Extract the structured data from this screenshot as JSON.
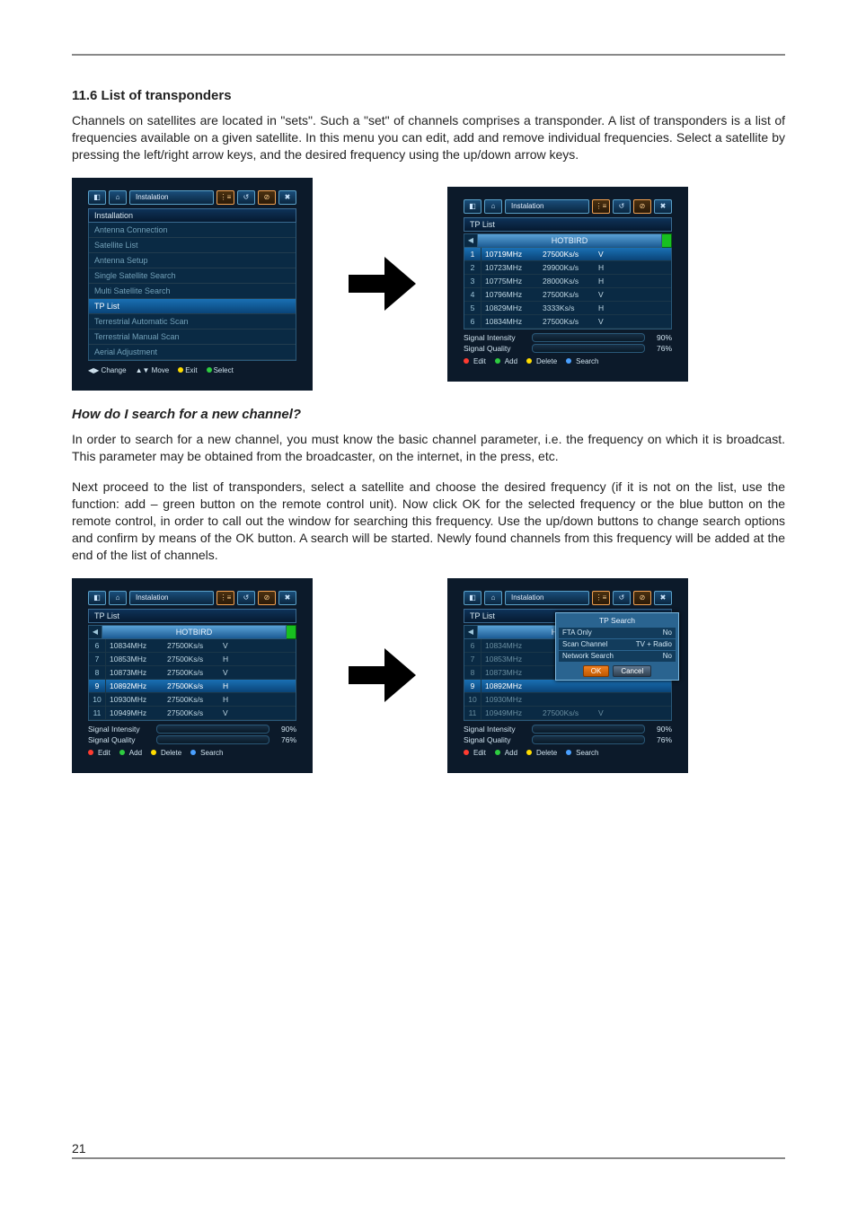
{
  "page_number": "21",
  "section_heading": "11.6 List of transponders",
  "para1": "Channels on satellites are located in \"sets\". Such a \"set\" of channels comprises a transponder. A list of transponders is a list of frequencies available on a given satellite. In this menu you can edit, add and remove individual frequencies. Select a satellite by pressing the left/right arrow keys, and the desired frequency using the up/down arrow keys.",
  "subquestion": "How do I search for a new channel?",
  "para2": "In order to search for a new channel, you must know the basic channel parameter, i.e. the frequency on which it is broadcast. This parameter may be obtained from the broadcaster, on the internet, in the press, etc.",
  "para3": "Next proceed to the list of transponders, select a satellite and choose the desired frequency (if it is not on the list, use the function: add – green button on the remote control unit). Now click OK for the selected frequency or the blue button on the remote control, in order to call out the window for searching this frequency. Use the up/down buttons to change search options and confirm by means of the OK button. A search will be started. Newly found channels from this frequency will be added at the end of the list of channels.",
  "tv_header_title": "Instalation",
  "hicons": [
    "◧",
    "⌂",
    "⋮≡",
    "↺",
    "⊘",
    "✖"
  ],
  "install_menu": {
    "title": "Installation",
    "items": [
      "Antenna Connection",
      "Satellite List",
      "Antenna Setup",
      "Single Satellite Search",
      "Multi Satellite Search",
      "TP List",
      "Terrestrial Automatic Scan",
      "Terrestrial Manual Scan",
      "Aerial Adjustment"
    ],
    "selected": 5,
    "hints": {
      "change": "Change",
      "move": "Move",
      "exit": "Exit",
      "select": "Select",
      "chlabel": "◀▶",
      "mvlabel": "▲▼"
    }
  },
  "tplist": {
    "title": "TP List",
    "corner_glyph": "◀",
    "satellite": "HOTBIRD",
    "rows1": [
      {
        "num": "1",
        "freq": "10719MHz",
        "sr": "27500Ks/s",
        "pol": "V",
        "sel": true
      },
      {
        "num": "2",
        "freq": "10723MHz",
        "sr": "29900Ks/s",
        "pol": "H"
      },
      {
        "num": "3",
        "freq": "10775MHz",
        "sr": "28000Ks/s",
        "pol": "H"
      },
      {
        "num": "4",
        "freq": "10796MHz",
        "sr": "27500Ks/s",
        "pol": "V"
      },
      {
        "num": "5",
        "freq": "10829MHz",
        "sr": "3333Ks/s",
        "pol": "H"
      },
      {
        "num": "6",
        "freq": "10834MHz",
        "sr": "27500Ks/s",
        "pol": "V"
      }
    ],
    "rows2": [
      {
        "num": "6",
        "freq": "10834MHz",
        "sr": "27500Ks/s",
        "pol": "V"
      },
      {
        "num": "7",
        "freq": "10853MHz",
        "sr": "27500Ks/s",
        "pol": "H"
      },
      {
        "num": "8",
        "freq": "10873MHz",
        "sr": "27500Ks/s",
        "pol": "V"
      },
      {
        "num": "9",
        "freq": "10892MHz",
        "sr": "27500Ks/s",
        "pol": "H",
        "sel": true
      },
      {
        "num": "10",
        "freq": "10930MHz",
        "sr": "27500Ks/s",
        "pol": "H"
      },
      {
        "num": "11",
        "freq": "10949MHz",
        "sr": "27500Ks/s",
        "pol": "V"
      }
    ],
    "rows3": [
      {
        "num": "6",
        "freq": "10834MHz",
        "sr": "",
        "pol": "",
        "dim": true
      },
      {
        "num": "7",
        "freq": "10853MHz",
        "sr": "",
        "pol": "",
        "dim": true
      },
      {
        "num": "8",
        "freq": "10873MHz",
        "sr": "",
        "pol": "",
        "dim": true
      },
      {
        "num": "9",
        "freq": "10892MHz",
        "sr": "",
        "pol": "",
        "sel": true
      },
      {
        "num": "10",
        "freq": "10930MHz",
        "sr": "",
        "pol": "",
        "dim": true
      },
      {
        "num": "11",
        "freq": "10949MHz",
        "sr": "27500Ks/s",
        "pol": "V",
        "dim": true
      }
    ],
    "signal_intensity_label": "Signal Intensity",
    "signal_quality_label": "Signal Quality",
    "intensity_pct": "90%",
    "quality_pct": "76%",
    "btns": {
      "edit": "Edit",
      "add": "Add",
      "delete": "Delete",
      "search": "Search"
    }
  },
  "popup": {
    "title": "TP Search",
    "rows": [
      {
        "k": "FTA Only",
        "v": "No"
      },
      {
        "k": "Scan Channel",
        "v": "TV + Radio"
      },
      {
        "k": "Network Search",
        "v": "No"
      }
    ],
    "ok": "OK",
    "cancel": "Cancel"
  }
}
